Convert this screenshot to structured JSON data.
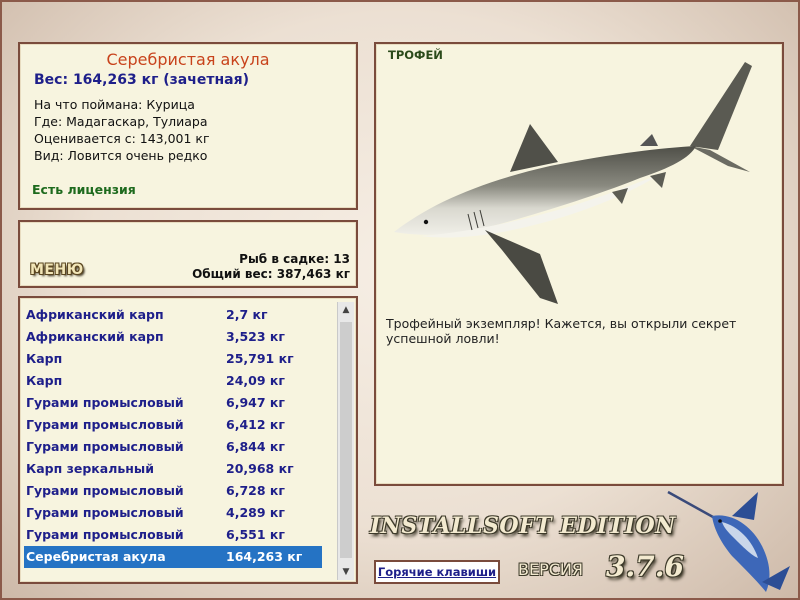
{
  "catch": {
    "fish_name": "Серебристая акула",
    "weight_line": "Вес: 164,263 кг (зачетная)",
    "details": [
      "На что поймана: Курица",
      "Где: Мадагаскар, Тулиара",
      "Оценивается с: 143,001 кг",
      "Вид: Ловится очень редко"
    ],
    "license": "Есть лицензия"
  },
  "menu": {
    "button_label": "МЕНЮ",
    "fish_in_keepnet": "Рыб в садке: 13",
    "total_weight": "Общий вес: 387,463 кг"
  },
  "keepnet": {
    "rows": [
      {
        "name": "Африканский карп",
        "weight": "2,7 кг",
        "selected": false
      },
      {
        "name": "Африканский карп",
        "weight": "3,523 кг",
        "selected": false
      },
      {
        "name": "Карп",
        "weight": "25,791 кг",
        "selected": false
      },
      {
        "name": "Карп",
        "weight": "24,09 кг",
        "selected": false
      },
      {
        "name": "Гурами промысловый",
        "weight": "6,947 кг",
        "selected": false
      },
      {
        "name": "Гурами промысловый",
        "weight": "6,412 кг",
        "selected": false
      },
      {
        "name": "Гурами промысловый",
        "weight": "6,844 кг",
        "selected": false
      },
      {
        "name": "Карп зеркальный",
        "weight": "20,968 кг",
        "selected": false
      },
      {
        "name": "Гурами промысловый",
        "weight": "6,728 кг",
        "selected": false
      },
      {
        "name": "Гурами промысловый",
        "weight": "4,289 кг",
        "selected": false
      },
      {
        "name": "Гурами промысловый",
        "weight": "6,551 кг",
        "selected": false
      },
      {
        "name": "Серебристая акула",
        "weight": "164,263 кг",
        "selected": true
      }
    ]
  },
  "trophy": {
    "label": "ТРОФЕЙ",
    "description": "Трофейный экземпляр! Кажется, вы открыли секрет успешной ловли!"
  },
  "footer": {
    "brand": "INSTALLSOFT EDITION",
    "version_label": "ВЕРСИЯ",
    "version_number": "3.7.6",
    "hotkeys_link": "Горячие клавиши"
  },
  "colors": {
    "fish_name": "#c8431c",
    "weight": "#1e1f8a",
    "license": "#1d6a1d",
    "selection": "#2573c4",
    "border": "#7a4b3c"
  }
}
